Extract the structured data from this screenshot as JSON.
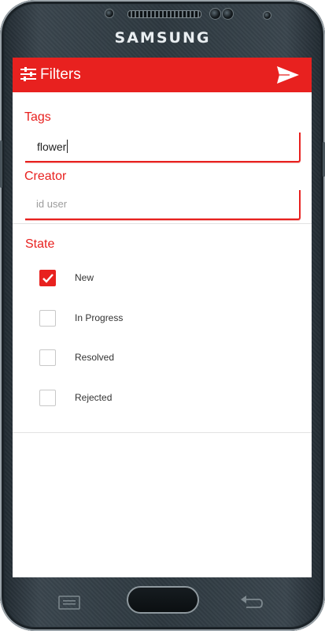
{
  "device": {
    "brand": "SAMSUNG"
  },
  "appbar": {
    "title": "Filters",
    "filter_icon": "sliders-icon",
    "send_icon": "send-icon"
  },
  "tags": {
    "label": "Tags",
    "value": "flower"
  },
  "creator": {
    "label": "Creator",
    "placeholder": "id user",
    "value": ""
  },
  "state": {
    "label": "State",
    "options": [
      {
        "label": "New",
        "checked": true
      },
      {
        "label": "In Progress",
        "checked": false
      },
      {
        "label": "Resolved",
        "checked": false
      },
      {
        "label": "Rejected",
        "checked": false
      }
    ]
  },
  "colors": {
    "accent": "#e8211f",
    "device_body": "#2d383f"
  }
}
